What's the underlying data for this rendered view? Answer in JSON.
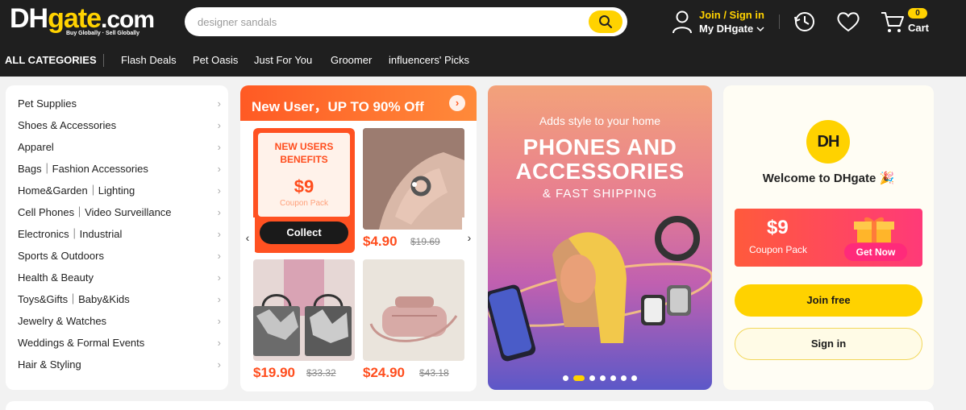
{
  "header": {
    "logo": {
      "main": "DH",
      "gate": "gate",
      "dotcom": ".com",
      "tagline": "Buy Globally · Sell Globally"
    },
    "search": {
      "placeholder": "designer sandals"
    },
    "account": {
      "join_label": "Join / Sign in",
      "my_label": "My DHgate"
    },
    "cart": {
      "count": "0",
      "label": "Cart"
    },
    "icons": [
      "user-icon",
      "history-icon",
      "heart-icon",
      "cart-icon",
      "search-icon",
      "chevron-down-icon"
    ]
  },
  "nav": {
    "all": "ALL CATEGORIES",
    "items": [
      "Flash Deals",
      "Pet Oasis",
      "Just For You",
      "Groomer",
      "influencers' Picks"
    ]
  },
  "categories": [
    "Pet Supplies",
    "Shoes & Accessories",
    "Apparel",
    "Bags｜Fashion Accessories",
    "Home&Garden｜Lighting",
    "Cell Phones｜Video Surveillance",
    "Electronics｜Industrial",
    "Sports & Outdoors",
    "Health & Beauty",
    "Toys&Gifts｜Baby&Kids",
    "Jewelry & Watches",
    "Weddings & Formal Events",
    "Hair & Styling"
  ],
  "new_user": {
    "title": "New User，UP TO 90% Off",
    "coupon": {
      "title_line1": "NEW USERS",
      "title_line2": "BENEFITS",
      "amount": "$9",
      "pack": "Coupon Pack",
      "collect": "Collect"
    },
    "products": [
      {
        "price": "$4.90",
        "old_price": "$19.69"
      },
      {
        "price": "$19.90",
        "old_price": "$33.32"
      },
      {
        "price": "$24.90",
        "old_price": "$43.18"
      }
    ]
  },
  "banner": {
    "subtitle": "Adds style to your home",
    "headline_1": "PHONES AND",
    "headline_2": "ACCESSORIES",
    "headline_3": "& FAST SHIPPING",
    "dots_total": 7,
    "dots_active_index": 1
  },
  "welcome": {
    "badge": "DH",
    "text": "Welcome to DHgate 🎉",
    "coupon_amount": "$9",
    "coupon_pack": "Coupon Pack",
    "get_now": "Get Now",
    "join_free": "Join free",
    "sign_in": "Sign in"
  },
  "colors": {
    "brand_yellow": "#ffd200",
    "accent_orange": "#ff4d1d",
    "header_bg": "#1f1f1f"
  }
}
